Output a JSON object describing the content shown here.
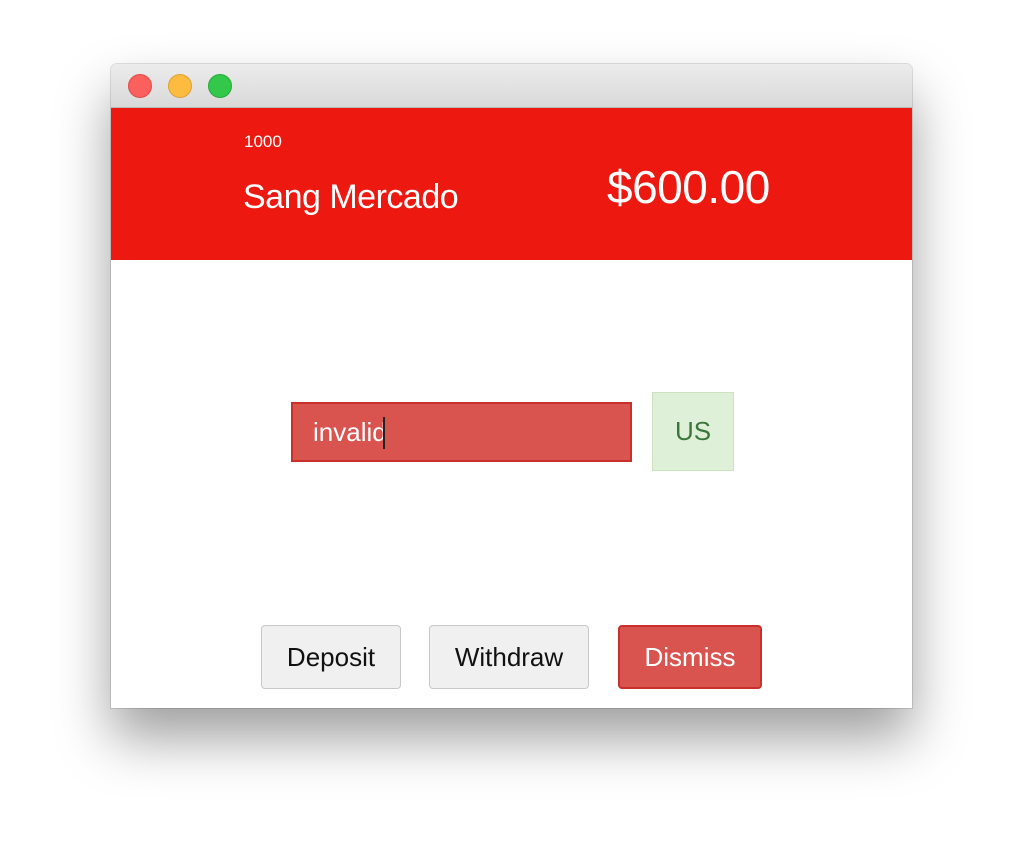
{
  "window": {
    "controls": [
      {
        "icon": "close-icon",
        "color": "#fc605c"
      },
      {
        "icon": "minimize-icon",
        "color": "#fdbc40"
      },
      {
        "icon": "zoom-icon",
        "color": "#34c84a"
      }
    ]
  },
  "account": {
    "number": "1000",
    "name": "Sang Mercado",
    "balance": "$600.00",
    "header_color": "#ed1911"
  },
  "transaction": {
    "amount_value": "invalid",
    "amount_state": "invalid",
    "currency": "US"
  },
  "actions": {
    "deposit_label": "Deposit",
    "withdraw_label": "Withdraw",
    "dismiss_label": "Dismiss"
  },
  "colors": {
    "error": "#d9534f",
    "success_bg": "#dff0d8",
    "success_text": "#3c763d"
  }
}
